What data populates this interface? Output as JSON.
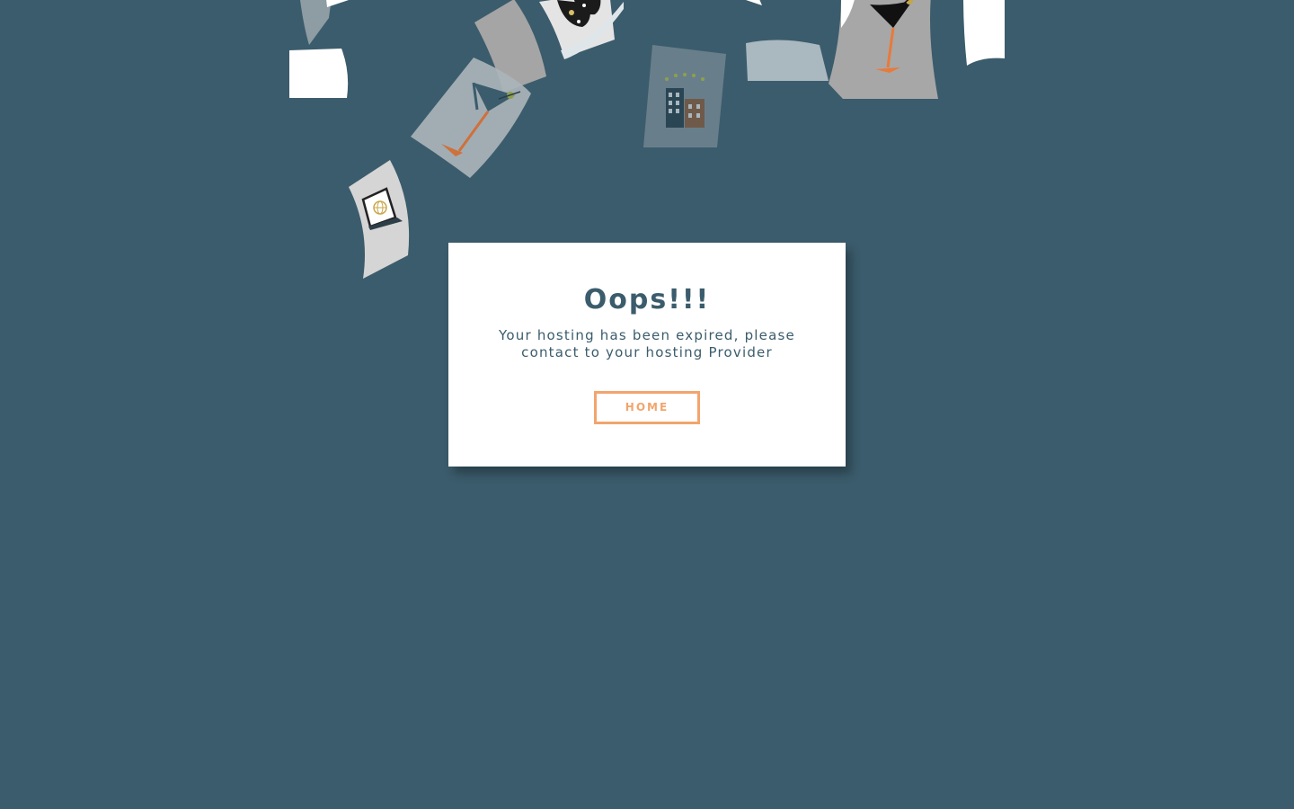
{
  "error": {
    "title": "Oops!!!",
    "message": "Your hosting has been expired, please contact to your hosting Provider",
    "home_label": "HOME"
  },
  "colors": {
    "background": "#3b5c6c",
    "card": "#ffffff",
    "text": "#3b5c6c",
    "accent": "#f2a56d"
  },
  "decorations": [
    "cocktail-icon",
    "building-icon",
    "laptop-globe-icon",
    "sunglasses-icon"
  ]
}
